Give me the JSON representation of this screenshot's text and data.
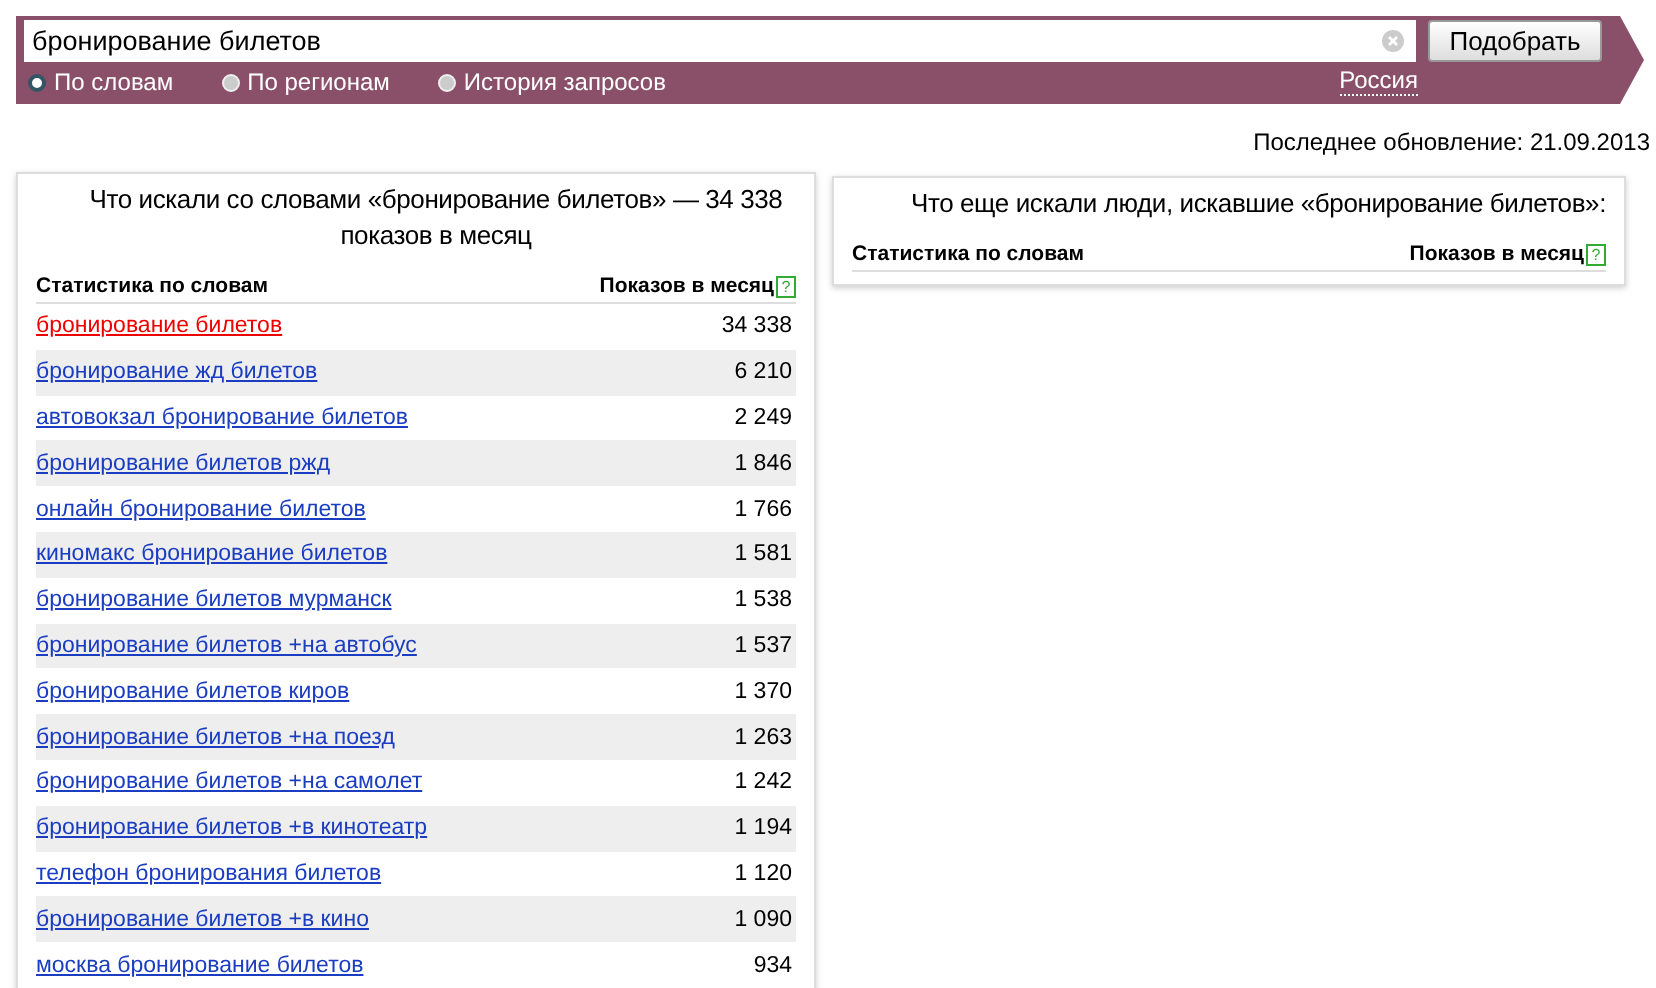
{
  "search": {
    "value": "бронирование билетов",
    "button": "Подобрать",
    "modes": [
      {
        "label": "По словам",
        "selected": true
      },
      {
        "label": "По регионам",
        "selected": false
      },
      {
        "label": "История запросов",
        "selected": false
      }
    ],
    "region": "Россия"
  },
  "last_update": "Последнее обновление: 21.09.2013",
  "main_panel": {
    "title": "Что искали со словами «бронирование билетов» — 34 338 показов в месяц",
    "columns": [
      {
        "label": "Статистика по словам"
      },
      {
        "label": "Показов в месяц",
        "help": "?"
      }
    ],
    "rows": [
      {
        "phrase": "бронирование билетов",
        "count": "34 338",
        "current": true
      },
      {
        "phrase": "бронирование жд билетов",
        "count": "6 210",
        "current": false
      },
      {
        "phrase": "автовокзал бронирование билетов",
        "count": "2 249",
        "current": false
      },
      {
        "phrase": "бронирование билетов ржд",
        "count": "1 846",
        "current": false
      },
      {
        "phrase": "онлайн бронирование билетов",
        "count": "1 766",
        "current": false
      },
      {
        "phrase": "киномакс бронирование билетов",
        "count": "1 581",
        "current": false
      },
      {
        "phrase": "бронирование билетов мурманск",
        "count": "1 538",
        "current": false
      },
      {
        "phrase": "бронирование билетов +на автобус",
        "count": "1 537",
        "current": false
      },
      {
        "phrase": "бронирование билетов киров",
        "count": "1 370",
        "current": false
      },
      {
        "phrase": "бронирование билетов +на поезд",
        "count": "1 263",
        "current": false
      },
      {
        "phrase": "бронирование билетов +на самолет",
        "count": "1 242",
        "current": false
      },
      {
        "phrase": "бронирование билетов +в кинотеатр",
        "count": "1 194",
        "current": false
      },
      {
        "phrase": "телефон бронирования билетов",
        "count": "1 120",
        "current": false
      },
      {
        "phrase": "бронирование билетов +в кино",
        "count": "1 090",
        "current": false
      },
      {
        "phrase": "москва бронирование билетов",
        "count": "934",
        "current": false
      }
    ]
  },
  "side_panel": {
    "title": "Что еще искали люди, искавшие «бронирование билетов»:",
    "columns": [
      {
        "label": "Статистика по словам"
      },
      {
        "label": "Показов в месяц",
        "help": "?"
      }
    ]
  }
}
